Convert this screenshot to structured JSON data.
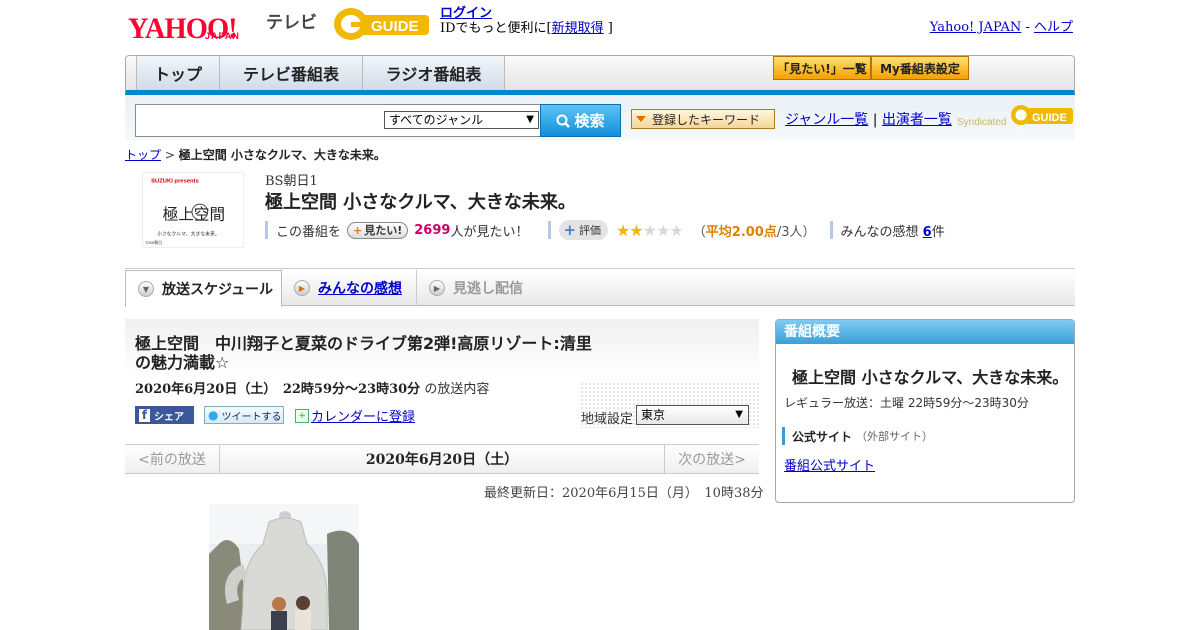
{
  "header": {
    "yahoo_logo": "YAHOO!",
    "yahoo_sub": "JAPAN",
    "tv_label": "テレビ",
    "gguide_logo": "G-GUIDE",
    "login_link": "ログイン",
    "login_note_prefix": "IDでもっと便利に[",
    "register_link": "新規取得",
    "login_note_suffix": "]",
    "yahoo_japan_link": "Yahoo! JAPAN",
    "sep": " - ",
    "help_link": "ヘルプ"
  },
  "nav": {
    "tabs": [
      "トップ",
      "テレビ番組表",
      "ラジオ番組表"
    ],
    "mitai_list": "「見たい!」一覧",
    "my_schedule": "My番組表設定"
  },
  "search": {
    "input_value": "",
    "genre_selected": "すべてのジャンル",
    "search_button": "検索",
    "keyword_button": "登録したキーワード",
    "genre_list_link": "ジャンル一覧",
    "link_sep": "|",
    "cast_list_link": "出演者一覧",
    "syndicated": "Syndicated"
  },
  "breadcrumb": {
    "home": "トップ",
    "sep": " > ",
    "current": "極上空間 小さなクルマ、大きな未来。"
  },
  "program": {
    "thumb_brand": "SUZUKI presents",
    "thumb_title": "極上空間",
    "thumb_sub": "小さなクルマ、大きな未来。",
    "thumb_credit": "©BS朝日",
    "channel": "BS朝日1",
    "title": "極上空間 小さなクルマ、大きな未来。",
    "mitai_prefix": "この番組を",
    "mitai_button": "見たい!",
    "mitai_count": "2699",
    "mitai_suffix": "人が見たい！",
    "hyoka_button": "評価",
    "rating_stars": 2,
    "rating_max": 5,
    "avg_open": "（",
    "avg_label": "平均2.00点",
    "avg_count": "/3人）",
    "kanso_label": "みんなの感想",
    "kanso_count": "6",
    "kanso_unit": "件"
  },
  "tabs": {
    "schedule": "放送スケジュール",
    "impressions": "みんなの感想",
    "missed": "見逃し配信"
  },
  "episode": {
    "title": "極上空間　中川翔子と夏菜のドライブ第2弾!高原リゾート:清里の魅力満載☆",
    "datetime": "2020年6月20日（土）　22時59分～23時30分",
    "datetime_suffix": "の放送内容",
    "share_fb": "シェア",
    "share_tw": "ツイートする",
    "calendar": "カレンダーに登録",
    "region_label": "地域設定",
    "region_selected": "東京",
    "prev": "<前の放送",
    "current_date": "2020年6月20日（土）",
    "next": "次の放送>",
    "updated": "最終更新日：2020年6月15日（月）　10時38分"
  },
  "sidebar": {
    "header": "番組概要",
    "title": "極上空間 小さなクルマ、大きな未来。",
    "regular": "レギュラー放送：土曜 22時59分～23時30分",
    "official_label": "公式サイト",
    "official_sub": "（外部サイト）",
    "official_link": "番組公式サイト"
  },
  "colors": {
    "yahoo_red": "#ff0033",
    "accent_blue": "#0088cc",
    "gguide_yellow": "#f0b800",
    "count_pink": "#cc0066",
    "star_gold": "#f2b600"
  }
}
